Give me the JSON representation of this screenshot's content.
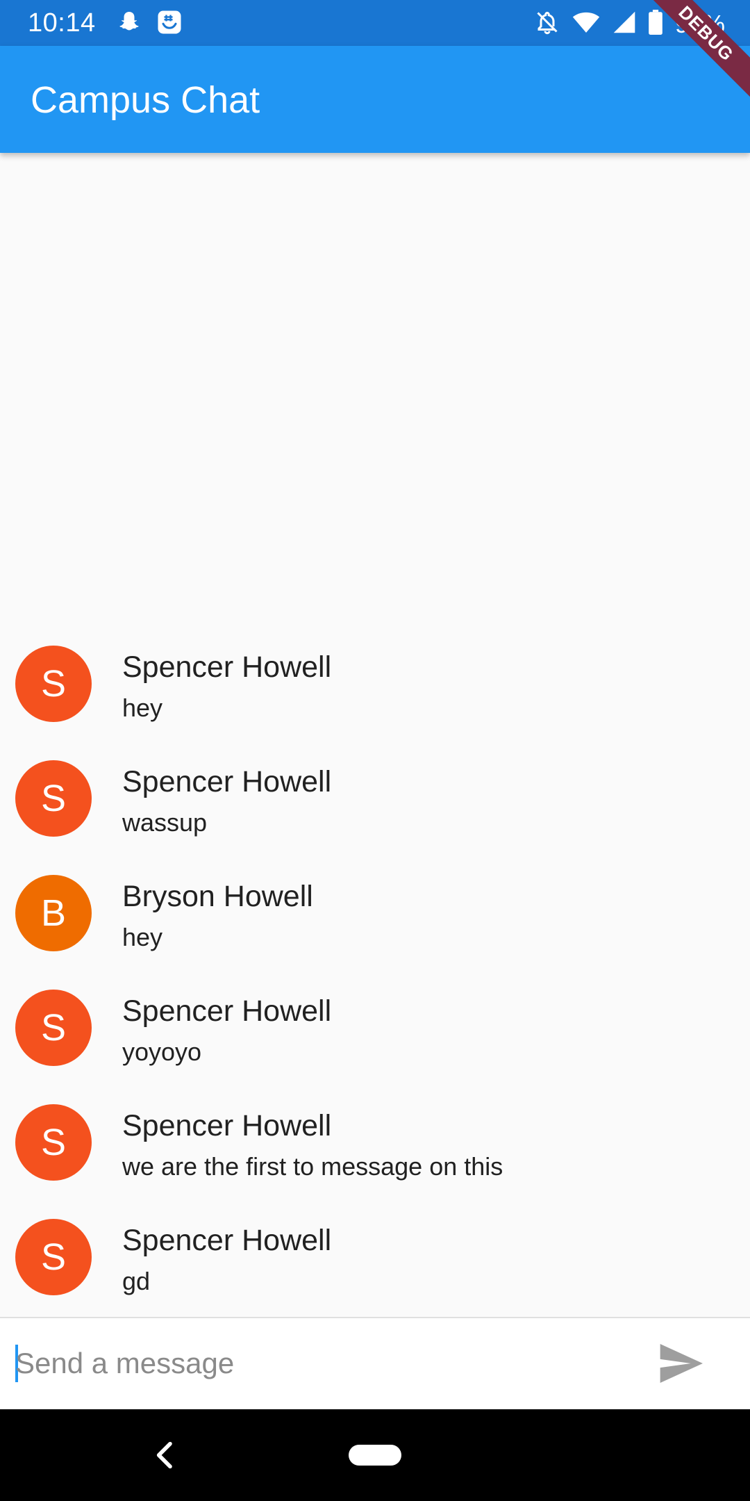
{
  "status_bar": {
    "time": "10:14",
    "battery": "99%",
    "icons_left": [
      "snapchat-icon",
      "groupme-icon"
    ],
    "icons_right": [
      "notifications-off-icon",
      "wifi-icon",
      "cell-signal-icon",
      "battery-icon"
    ]
  },
  "debug_banner": "DEBUG",
  "app_bar": {
    "title": "Campus Chat",
    "color": "#2196f3"
  },
  "messages": [
    {
      "initial": "S",
      "sender": "Spencer Howell",
      "text": "hey",
      "avatar_color": "#f4511e"
    },
    {
      "initial": "S",
      "sender": "Spencer Howell",
      "text": "wassup",
      "avatar_color": "#f4511e"
    },
    {
      "initial": "B",
      "sender": "Bryson Howell",
      "text": "hey",
      "avatar_color": "#ef6c00"
    },
    {
      "initial": "S",
      "sender": "Spencer Howell",
      "text": "yoyoyo",
      "avatar_color": "#f4511e"
    },
    {
      "initial": "S",
      "sender": "Spencer Howell",
      "text": "we are the first to message on this",
      "avatar_color": "#f4511e"
    },
    {
      "initial": "S",
      "sender": "Spencer Howell",
      "text": "gd",
      "avatar_color": "#f4511e"
    }
  ],
  "composer": {
    "placeholder": "Send a message",
    "value": "",
    "send_icon": "send-icon"
  },
  "nav_bar": {
    "icons": [
      "back-icon",
      "home-pill-icon"
    ]
  }
}
